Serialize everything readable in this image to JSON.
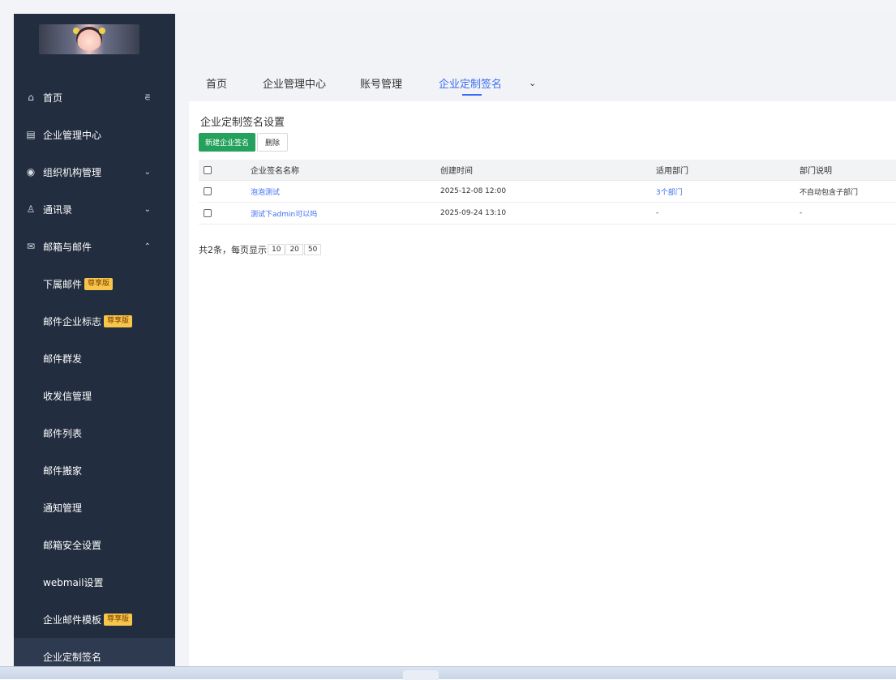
{
  "sidebar": {
    "items": [
      {
        "icon": "home-icon",
        "label": "首页",
        "glyph": "⌂"
      },
      {
        "icon": "grid-icon",
        "label": "企业管理中心",
        "glyph": "▤"
      },
      {
        "icon": "layers-icon",
        "label": "组织机构管理",
        "glyph": "◉"
      },
      {
        "icon": "contacts-icon",
        "label": "通讯录",
        "glyph": "♙"
      },
      {
        "icon": "mail-icon",
        "label": "邮箱与邮件",
        "glyph": "✉"
      }
    ],
    "subitems": [
      {
        "label": "下属邮件",
        "badge": "尊享版"
      },
      {
        "label": "邮件企业标志",
        "badge": "尊享版"
      },
      {
        "label": "邮件群发",
        "badge": ""
      },
      {
        "label": "收发信管理",
        "badge": ""
      },
      {
        "label": "邮件列表",
        "badge": ""
      },
      {
        "label": "邮件搬家",
        "badge": ""
      },
      {
        "label": "通知管理",
        "badge": ""
      },
      {
        "label": "邮箱安全设置",
        "badge": ""
      },
      {
        "label": "webmail设置",
        "badge": ""
      },
      {
        "label": "企业邮件模板",
        "badge": "尊享版"
      },
      {
        "label": "企业定制签名",
        "badge": ""
      }
    ],
    "collapse_glyph": "⋷"
  },
  "tabs": [
    {
      "label": "首页"
    },
    {
      "label": "企业管理中心"
    },
    {
      "label": "账号管理"
    },
    {
      "label": "企业定制签名"
    }
  ],
  "section_title": "企业定制签名设置",
  "buttons": {
    "new": "新建企业签名",
    "delete": "删除"
  },
  "table": {
    "headers": [
      "企业签名名称",
      "创建时间",
      "适用部门",
      "部门说明"
    ],
    "rows": [
      {
        "name": "泡泡测试",
        "time": "2025-12-08 12:00",
        "dept": "3个部门",
        "desc": "不自动包含子部门"
      },
      {
        "name": "测试下admin可以吗",
        "time": "2025-09-24 13:10",
        "dept": "-",
        "desc": "-"
      }
    ]
  },
  "pager": {
    "summary": "共2条，每页显示",
    "sizes": [
      "10",
      "20",
      "50"
    ]
  },
  "colors": {
    "sidebar": "#222d3f",
    "accent": "#3a6cf4",
    "primary_button": "#24a15c",
    "badge": "#f6c54a"
  }
}
